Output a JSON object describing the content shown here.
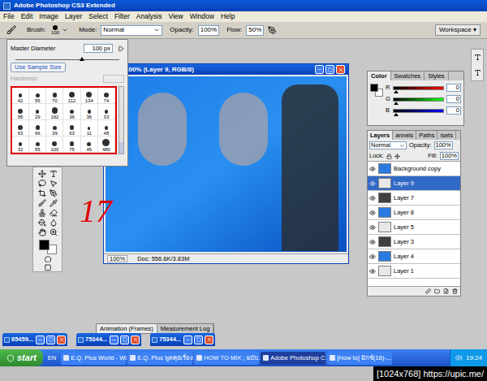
{
  "window": {
    "title": "Adobe Photoshop CS3 Extended"
  },
  "menu": [
    "File",
    "Edit",
    "Image",
    "Layer",
    "Select",
    "Filter",
    "Analysis",
    "View",
    "Window",
    "Help"
  ],
  "options_bar": {
    "brush_label": "Brush:",
    "brush_size": "100",
    "mode_label": "Mode:",
    "mode": "Normal",
    "opacity_label": "Opacity:",
    "opacity": "100%",
    "flow_label": "Flow:",
    "flow": "50%",
    "workspace": "Workspace ▾"
  },
  "brush_picker": {
    "master_diameter_label": "Master Diameter",
    "master_diameter": "100 px",
    "level": 0.62,
    "sample_button": "Use Sample Size",
    "hardness_label": "Hardness:",
    "hardness_disabled": true,
    "highlighted": true,
    "brushes": [
      "42",
      "55",
      "70",
      "112",
      "134",
      "74",
      "95",
      "29",
      "192",
      "36",
      "36",
      "33",
      "63",
      "66",
      "39",
      "63",
      "11",
      "48",
      "32",
      "55",
      "100",
      "75",
      "45",
      "480"
    ]
  },
  "annotation": "17",
  "document": {
    "title": "@ 100% (Layer 9, RGB/8)",
    "zoom": "100%",
    "doc_info": "Doc: 556.6K/3.83M"
  },
  "color_panel": {
    "tabs": [
      {
        "label": "Color",
        "selected": true
      },
      {
        "label": "Swatches",
        "selected": false
      },
      {
        "label": "Styles",
        "selected": false
      }
    ],
    "sliders": [
      {
        "name": "R",
        "value": "0",
        "level": 0,
        "color": "#ff0000"
      },
      {
        "name": "G",
        "value": "0",
        "level": 0,
        "color": "#00ff00"
      },
      {
        "name": "B",
        "value": "0",
        "level": 0,
        "color": "#0000ff"
      }
    ]
  },
  "layers_panel": {
    "tabs": [
      {
        "label": "Layers",
        "selected": true
      },
      {
        "label": "annels",
        "selected": false
      },
      {
        "label": "Paths",
        "selected": false
      },
      {
        "label": "isets",
        "selected": false
      }
    ],
    "blend": "Normal",
    "opacity_label": "Opacity:",
    "opacity": "100%",
    "lock_label": "Lock:",
    "fill_label": "Fill:",
    "fill": "100%",
    "layers": [
      {
        "name": "Background copy",
        "selected": false
      },
      {
        "name": "Layer 9",
        "selected": true
      },
      {
        "name": "Layer 7",
        "selected": false
      },
      {
        "name": "Layer 8",
        "selected": false
      },
      {
        "name": "Layer 5",
        "selected": false
      },
      {
        "name": "Layer 3",
        "selected": false
      },
      {
        "name": "Layer 4",
        "selected": false
      },
      {
        "name": "Layer 1",
        "selected": false
      }
    ]
  },
  "bottom_tabs": [
    {
      "label": "Animation (Frames)",
      "selected": true
    },
    {
      "label": "Measurement Log",
      "selected": false
    }
  ],
  "minimized": [
    "65459...",
    "75344...",
    "75344..."
  ],
  "taskbar": {
    "start": "start",
    "language": "EN",
    "tasks": [
      {
        "label": "E.Q. Plus World - Wi...",
        "selected": false
      },
      {
        "label": "E.Q. Plus พูดคุยเรื่อง...",
        "selected": false
      },
      {
        "label": "HOW TO MIX ; ฉบับ...",
        "selected": false
      },
      {
        "label": "Adobe Photoshop C...",
        "selected": true
      },
      {
        "label": "[How to] มิกซ์(16)-...",
        "selected": false
      }
    ],
    "clock": "19:24"
  },
  "watermark": "[1024x768] https://upic.me/"
}
